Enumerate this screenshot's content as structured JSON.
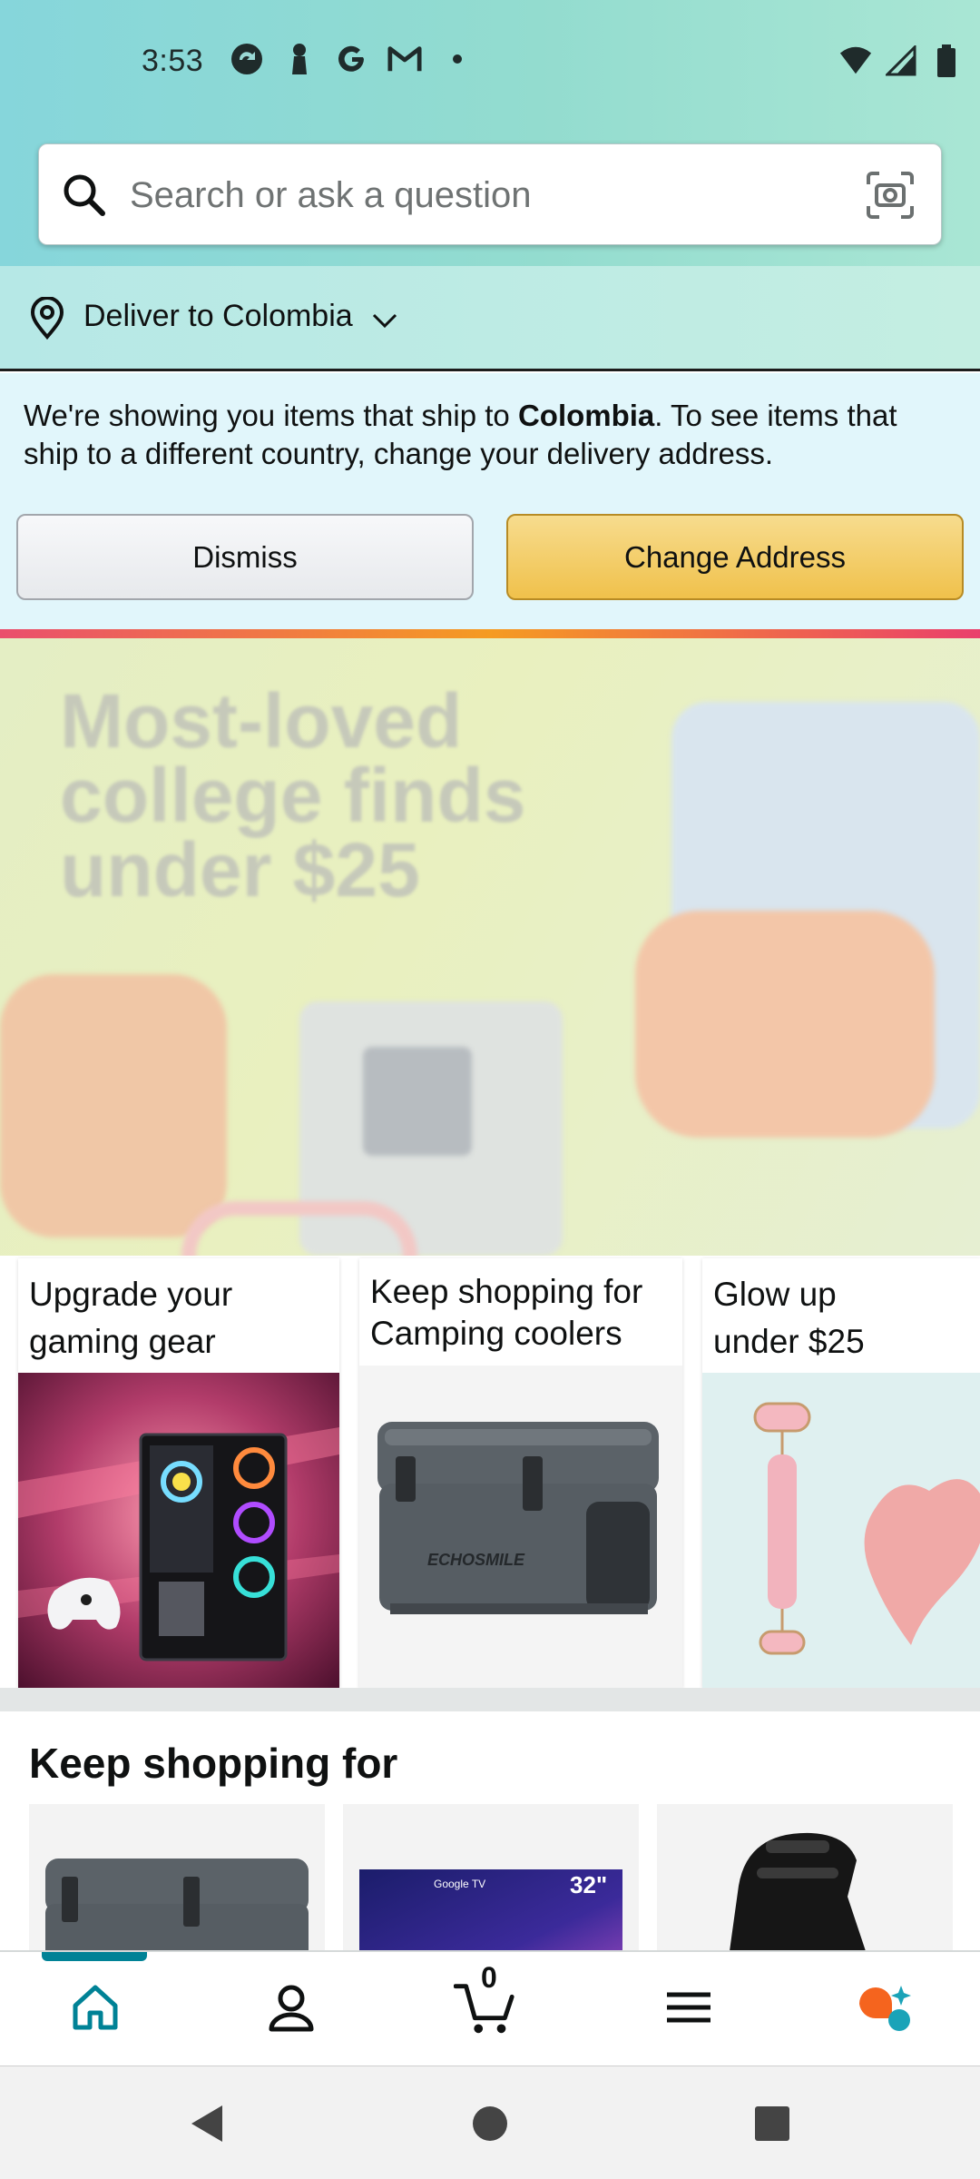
{
  "status_bar": {
    "time": "3:53"
  },
  "search": {
    "placeholder": "Search or ask a question"
  },
  "delivery": {
    "label": "Deliver to Colombia"
  },
  "notice": {
    "text_before": "We're showing you items that ship to ",
    "country": "Colombia",
    "text_after": ". To see items that ship to a different country, change your delivery address.",
    "dismiss_label": "Dismiss",
    "change_label": "Change Address"
  },
  "hero": {
    "title": "Most-loved college finds under $25"
  },
  "cards": [
    {
      "title": "Upgrade your gaming gear"
    },
    {
      "title": "Keep shopping for Camping coolers"
    },
    {
      "title": "Glow up under $25"
    }
  ],
  "cooler_brand": "ECHOSMILE",
  "keep_shopping": {
    "title": "Keep shopping for",
    "tv_brand": "Google TV",
    "tv_size": "32\""
  },
  "tabbar": {
    "items": [
      {
        "icon": "home-icon"
      },
      {
        "icon": "account-icon"
      },
      {
        "icon": "cart-icon"
      },
      {
        "icon": "menu-icon"
      },
      {
        "icon": "rufus-icon"
      }
    ],
    "cart_count": "0",
    "active_color": "#008296"
  },
  "colors": {
    "button_yellow": "#f0c14b",
    "accent_teal": "#008296"
  }
}
